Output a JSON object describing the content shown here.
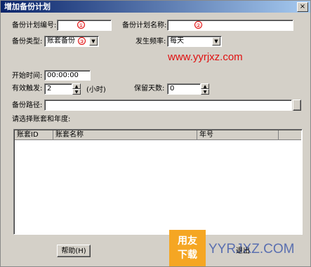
{
  "window": {
    "title": "增加备份计划",
    "close_glyph": "×"
  },
  "fields": {
    "plan_code_label": "备份计划编号:",
    "plan_code_marker": "①",
    "plan_name_label": "备份计划名称:",
    "plan_name_marker": "②",
    "backup_type_label": "备份类型:",
    "backup_type_value": "账套备份",
    "backup_type_marker": "③",
    "frequency_label": "发生频率:",
    "frequency_value": "每天",
    "start_time_label": "开始时间:",
    "start_time_value": "00:00:00",
    "trigger_label": "有效触发:",
    "trigger_value": "2",
    "trigger_unit": "(小时)",
    "retain_label": "保留天数:",
    "retain_value": "0",
    "path_label": "备份路径:",
    "path_value": ""
  },
  "list": {
    "caption": "请选择账套和年度:",
    "columns": [
      "账套ID",
      "账套名称",
      "年号"
    ],
    "rows": []
  },
  "buttons": {
    "help": "帮助(H)",
    "exit": "退出"
  },
  "watermarks": {
    "url_text": "www.yyrjxz.com",
    "logo_line1": "用友",
    "logo_line2": "下载",
    "url_text2": "YYRJXZ.COM"
  },
  "colors": {
    "title_start": "#0a246a",
    "title_end": "#a6caf0",
    "marker": "#e00000",
    "face": "#d4d0c8"
  }
}
